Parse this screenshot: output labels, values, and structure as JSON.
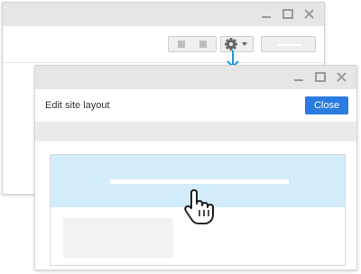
{
  "colors": {
    "titlebar": "#e6e6e6",
    "accent": "#2b7be0",
    "highlight": "#d2ecfb",
    "arrow": "#1a9ce0"
  },
  "back_window": {
    "controls": [
      "minimize-icon",
      "maximize-icon",
      "close-icon"
    ],
    "toolbar": {
      "buttons": [
        "segment-button",
        "gear-dropdown-button",
        "blank-button"
      ],
      "gear_icon": "gear-icon",
      "dropdown_icon": "caret-down-icon"
    }
  },
  "connector": {
    "icon": "arrow-down-icon"
  },
  "front_window": {
    "controls": [
      "minimize-icon",
      "maximize-icon",
      "close-icon"
    ],
    "title": "Edit site layout",
    "close_label": "Close",
    "canvas": {
      "cursor_icon": "hand-pointer-icon"
    }
  }
}
